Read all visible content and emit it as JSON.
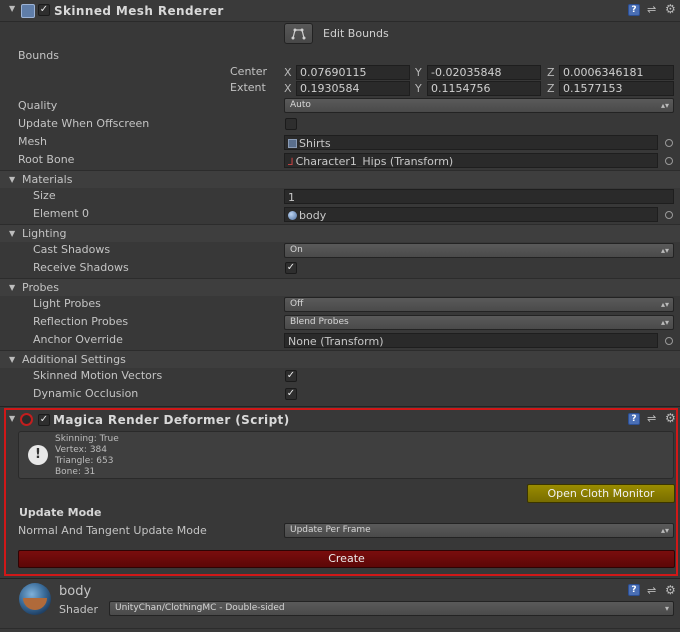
{
  "skinned": {
    "title": "Skinned Mesh Renderer",
    "edit_bounds_label": "Edit Bounds",
    "bounds_label": "Bounds",
    "center_label": "Center",
    "extent_label": "Extent",
    "center": {
      "x_label": "X",
      "y_label": "Y",
      "z_label": "Z",
      "x": "0.07690115",
      "y": "-0.02035848",
      "z": "0.0006346181"
    },
    "extent": {
      "x_label": "X",
      "y_label": "Y",
      "z_label": "Z",
      "x": "0.1930584",
      "y": "0.1154756",
      "z": "0.1577153"
    },
    "quality_label": "Quality",
    "quality_value": "Auto",
    "update_offscreen_label": "Update When Offscreen",
    "mesh_label": "Mesh",
    "mesh_value": "Shirts",
    "root_bone_label": "Root Bone",
    "root_bone_value": "Character1_Hips (Transform)",
    "materials": {
      "header": "Materials",
      "size_label": "Size",
      "size_value": "1",
      "element0_label": "Element 0",
      "element0_value": "body"
    },
    "lighting": {
      "header": "Lighting",
      "cast_shadows_label": "Cast Shadows",
      "cast_shadows_value": "On",
      "receive_shadows_label": "Receive Shadows"
    },
    "probes": {
      "header": "Probes",
      "light_probes_label": "Light Probes",
      "light_probes_value": "Off",
      "reflection_probes_label": "Reflection Probes",
      "reflection_probes_value": "Blend Probes",
      "anchor_override_label": "Anchor Override",
      "anchor_override_value": "None (Transform)"
    },
    "additional": {
      "header": "Additional Settings",
      "motion_vectors_label": "Skinned Motion Vectors",
      "dynamic_occlusion_label": "Dynamic Occlusion"
    }
  },
  "magica": {
    "title": "Magica Render Deformer (Script)",
    "info_lines": [
      "Skinning: True",
      "Vertex: 384",
      "Triangle: 653",
      "Bone: 31"
    ],
    "open_monitor_label": "Open Cloth Monitor",
    "update_mode_heading": "Update Mode",
    "normal_tangent_label": "Normal And Tangent Update Mode",
    "normal_tangent_value": "Update Per Frame",
    "create_label": "Create"
  },
  "material": {
    "name": "body",
    "shader_label": "Shader",
    "shader_value": "UnityChan/ClothingMC - Double-sided"
  },
  "colors": {
    "highlight_border": "#d01818",
    "create_button": "#6a0a0a",
    "open_monitor_button": "#8a7e00",
    "panel_bg": "#383838"
  }
}
